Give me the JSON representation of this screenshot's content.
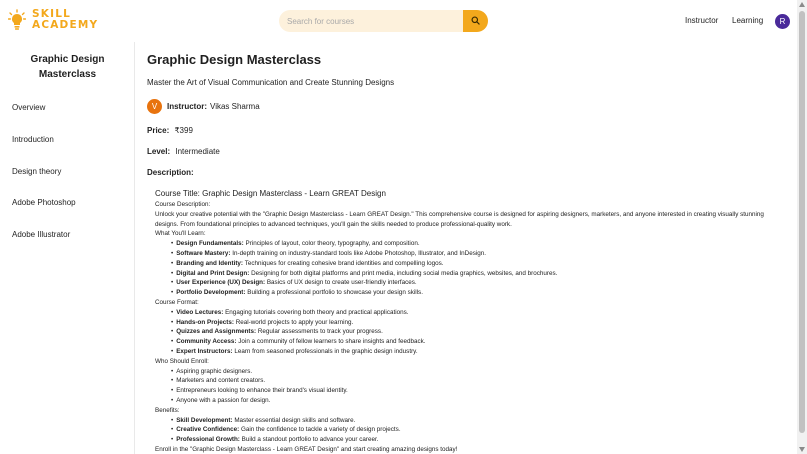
{
  "brand": {
    "line1": "SKILL",
    "line2": "ACADEMY",
    "accent": "#f3a81c"
  },
  "search": {
    "placeholder": "Search for courses",
    "icon": "search-icon"
  },
  "nav": {
    "instructor": "Instructor",
    "learning": "Learning",
    "avatar_initial": "R"
  },
  "sidebar": {
    "title": "Graphic Design Masterclass",
    "items": [
      {
        "label": "Overview"
      },
      {
        "label": "Introduction"
      },
      {
        "label": "Design theory"
      },
      {
        "label": "Adobe Photoshop"
      },
      {
        "label": "Adobe Illustrator"
      }
    ]
  },
  "course": {
    "title": "Graphic Design Masterclass",
    "subtitle": "Master the Art of Visual Communication and Create Stunning Designs",
    "instructor_initial": "V",
    "instructor_label": "Instructor:",
    "instructor_name": "Vikas Sharma",
    "price_label": "Price:",
    "price": "₹399",
    "level_label": "Level:",
    "level": "Intermediate",
    "description_label": "Description:"
  },
  "description": {
    "title": "Course Title: Graphic Design Masterclass - Learn GREAT Design",
    "course_description_label": "Course Description:",
    "intro": "Unlock your creative potential with the \"Graphic Design Masterclass - Learn GREAT Design.\" This comprehensive course is designed for aspiring designers, marketers, and anyone interested in creating visually stunning designs. From foundational principles to advanced techniques, you'll gain the skills needed to produce professional-quality work.",
    "learn_label": "What You'll Learn:",
    "learn": [
      {
        "term": "Design Fundamentals:",
        "text": "Principles of layout, color theory, typography, and composition."
      },
      {
        "term": "Software Mastery:",
        "text": "In-depth training on industry-standard tools like Adobe Photoshop, Illustrator, and InDesign."
      },
      {
        "term": "Branding and Identity:",
        "text": "Techniques for creating cohesive brand identities and compelling logos."
      },
      {
        "term": "Digital and Print Design:",
        "text": "Designing for both digital platforms and print media, including social media graphics, websites, and brochures."
      },
      {
        "term": "User Experience (UX) Design:",
        "text": "Basics of UX design to create user-friendly interfaces."
      },
      {
        "term": "Portfolio Development:",
        "text": "Building a professional portfolio to showcase your design skills."
      }
    ],
    "format_label": "Course Format:",
    "format": [
      {
        "term": "Video Lectures:",
        "text": "Engaging tutorials covering both theory and practical applications."
      },
      {
        "term": "Hands-on Projects:",
        "text": "Real-world projects to apply your learning."
      },
      {
        "term": "Quizzes and Assignments:",
        "text": "Regular assessments to track your progress."
      },
      {
        "term": "Community Access:",
        "text": "Join a community of fellow learners to share insights and feedback."
      },
      {
        "term": "Expert Instructors:",
        "text": "Learn from seasoned professionals in the graphic design industry."
      }
    ],
    "enroll_label": "Who Should Enroll:",
    "enroll": [
      "Aspiring graphic designers.",
      "Marketers and content creators.",
      "Entrepreneurs looking to enhance their brand's visual identity.",
      "Anyone with a passion for design."
    ],
    "benefits_label": "Benefits:",
    "benefits": [
      {
        "term": "Skill Development:",
        "text": "Master essential design skills and software."
      },
      {
        "term": "Creative Confidence:",
        "text": "Gain the confidence to tackle a variety of design projects."
      },
      {
        "term": "Professional Growth:",
        "text": "Build a standout portfolio to advance your career."
      }
    ],
    "closing": "Enroll in the \"Graphic Design Masterclass - Learn GREAT Design\" and start creating amazing designs today!"
  }
}
